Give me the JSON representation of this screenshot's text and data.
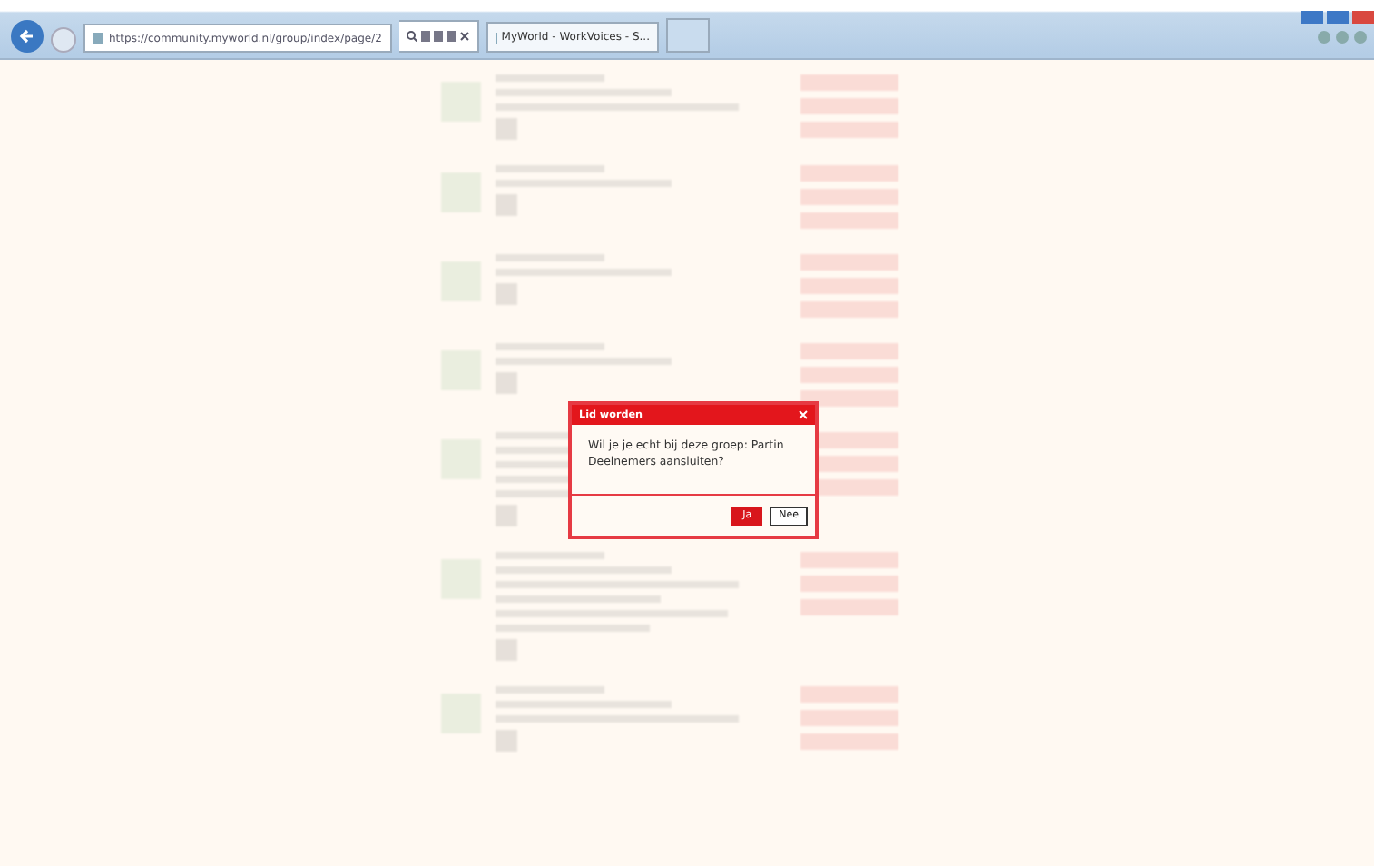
{
  "browser": {
    "url": "https://community.myworld.nl/group/index/page/2",
    "tab_title": "MyWorld - WorkVoices - S..."
  },
  "dialog": {
    "title": "Lid worden",
    "message": "Wil je je echt bij deze groep: Partin Deelnemers aansluiten?",
    "buttons": [
      {
        "label": "Ja",
        "primary": true
      },
      {
        "label": "Nee",
        "primary": false
      }
    ]
  }
}
